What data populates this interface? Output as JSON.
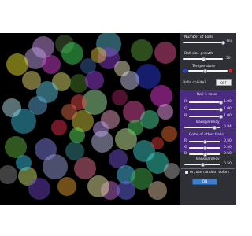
{
  "panel": {
    "num_balls": {
      "label": "Number of balls",
      "value": "100",
      "fraction": 1.0
    },
    "ball_size": {
      "label": "Ball size growth",
      "value": "50",
      "fraction": 0.5
    },
    "temperature": {
      "label": "Temperature",
      "fraction": 0.42,
      "cold_color": "#1f3fe6",
      "hot_color": "#e01f1f"
    },
    "balls_collide": {
      "label": "Balls collide?",
      "toggle_label": "OFF"
    },
    "ball1": {
      "title": "Ball 1 color",
      "r": {
        "label": "R",
        "value": "1.00",
        "fraction": 1.0
      },
      "g": {
        "label": "G",
        "value": "1.00",
        "fraction": 1.0
      },
      "b": {
        "label": "B",
        "value": "1.00",
        "fraction": 1.0
      },
      "transparency": {
        "label": "Transparency",
        "value": "0.84",
        "fraction": 0.84
      }
    },
    "others": {
      "title": "Color of other balls",
      "r": {
        "label": "R",
        "value": "0.50",
        "fraction": 0.5
      },
      "g": {
        "label": "G",
        "value": "0.50",
        "fraction": 0.5
      },
      "b": {
        "label": "B",
        "value": "0.50",
        "fraction": 0.5
      },
      "transparency": {
        "label": "Transparency",
        "value": "0.50",
        "fraction": 0.5
      }
    },
    "random_colors": {
      "label": "or, use random colors",
      "button_label": "ON"
    }
  },
  "balls": [
    {
      "c": "#7a5a8c"
    },
    {
      "c": "#4a6a3a"
    },
    {
      "c": "#5ab4c8"
    },
    {
      "c": "#3fd95e"
    },
    {
      "c": "#8a3ad0"
    },
    {
      "c": "#5a9a3a"
    },
    {
      "c": "#e0c040"
    },
    {
      "c": "#c0a0e8"
    },
    {
      "c": "#e8e030"
    },
    {
      "c": "#2a3ad8"
    },
    {
      "c": "#c8c8e8"
    },
    {
      "c": "#e0e070"
    },
    {
      "c": "#60c8e0"
    },
    {
      "c": "#4a7a2a"
    },
    {
      "c": "#e05090"
    },
    {
      "c": "#a0e8a0"
    },
    {
      "c": "#60a8d8"
    },
    {
      "c": "#a02060"
    },
    {
      "c": "#3ab8d0"
    },
    {
      "c": "#e050a0"
    },
    {
      "c": "#d0c840"
    },
    {
      "c": "#50d8a0"
    },
    {
      "c": "#e03050"
    },
    {
      "c": "#8080e0"
    },
    {
      "c": "#60b040"
    },
    {
      "c": "#e8a0c0"
    },
    {
      "c": "#c0c0e8"
    },
    {
      "c": "#e83ad8"
    },
    {
      "c": "#d0f0a0"
    },
    {
      "c": "#3a8a90"
    },
    {
      "c": "#e86a30"
    },
    {
      "c": "#7050d0"
    },
    {
      "c": "#40c8c8"
    },
    {
      "c": "#9aa0d8"
    },
    {
      "c": "#c8e070"
    },
    {
      "c": "#e07090"
    },
    {
      "c": "#50c0f0"
    },
    {
      "c": "#808080"
    },
    {
      "c": "#6a40c0"
    },
    {
      "c": "#c06ad0"
    },
    {
      "c": "#e8e8a0"
    },
    {
      "c": "#3ad8c0"
    },
    {
      "c": "#e0a030"
    },
    {
      "c": "#a040e0"
    },
    {
      "c": "#4ab050"
    },
    {
      "c": "#e84a4a"
    },
    {
      "c": "#b0e0e8"
    },
    {
      "c": "#e0c0a0"
    },
    {
      "c": "#d040d0"
    },
    {
      "c": "#3a60a0"
    },
    {
      "c": "#e8d870"
    },
    {
      "c": "#50d060"
    },
    {
      "c": "#c0a0f0"
    },
    {
      "c": "#e06a4a"
    },
    {
      "c": "#3ac0e0"
    },
    {
      "c": "#b0b0b0"
    },
    {
      "c": "#e8e0c0"
    },
    {
      "c": "#e03a3a"
    },
    {
      "c": "#60e060"
    },
    {
      "c": "#6a6ae8"
    },
    {
      "c": "#f0a0f0"
    }
  ]
}
